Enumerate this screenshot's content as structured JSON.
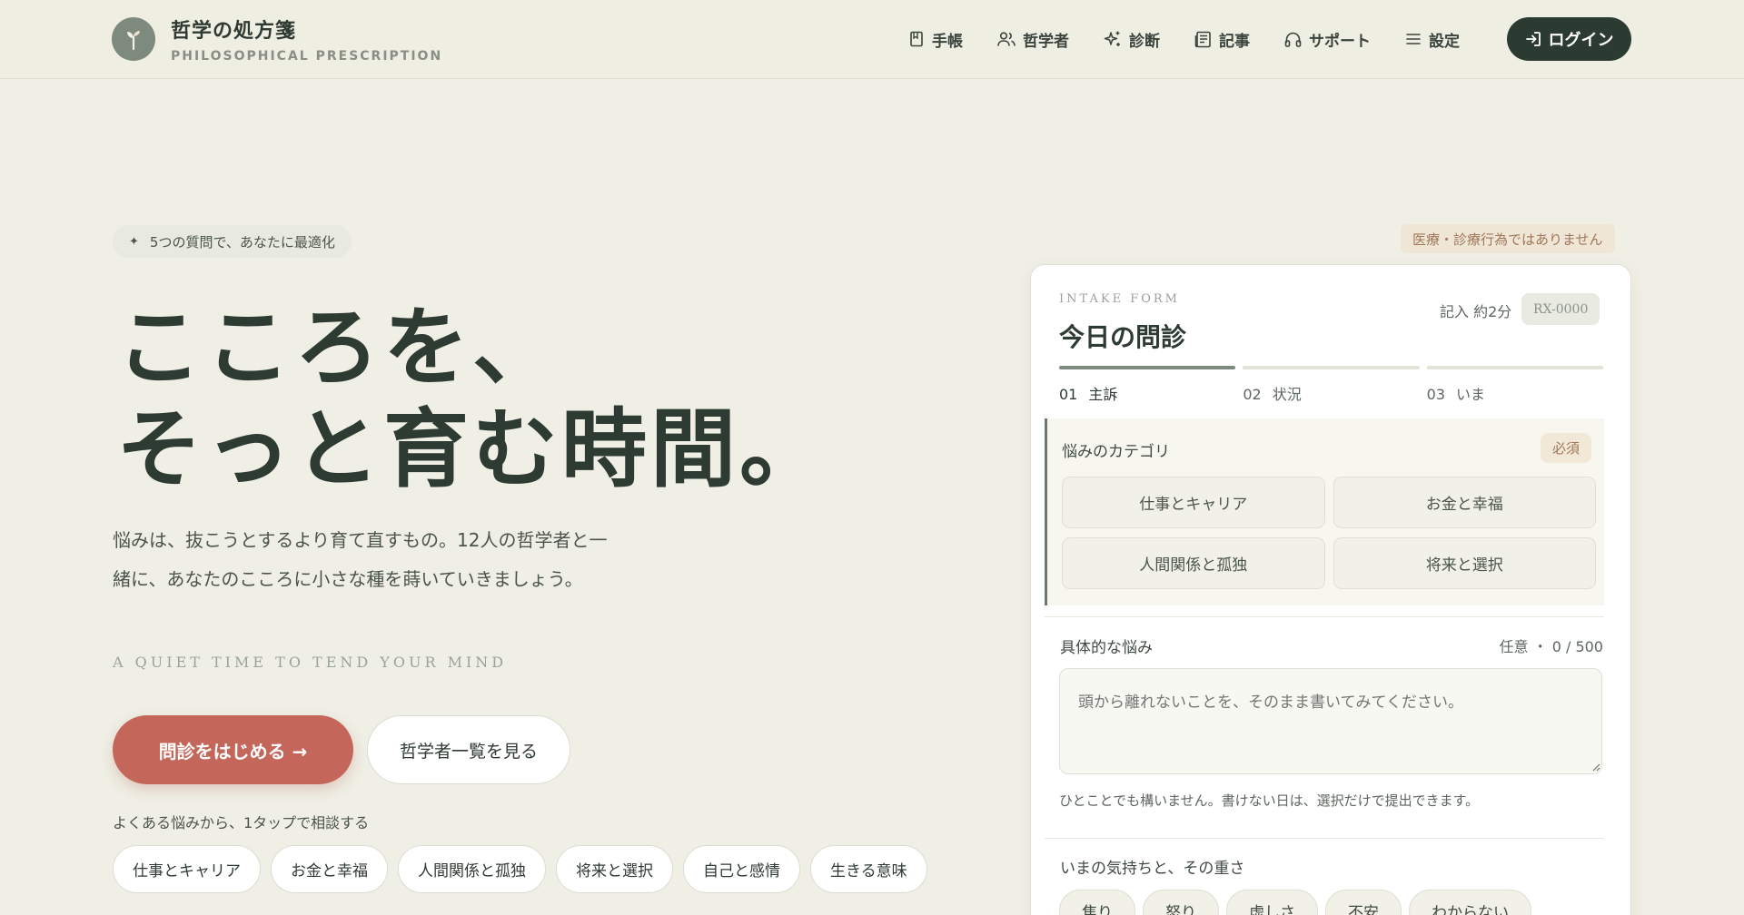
{
  "header": {
    "title": "哲学の処方箋",
    "subtitle": "PHILOSOPHICAL PRESCRIPTION",
    "nav": [
      {
        "label": "手帳",
        "icon": "notebook-icon"
      },
      {
        "label": "哲学者",
        "icon": "users-icon"
      },
      {
        "label": "診断",
        "icon": "sparkles-icon"
      },
      {
        "label": "記事",
        "icon": "newspaper-icon"
      },
      {
        "label": "サポート",
        "icon": "headphones-icon"
      },
      {
        "label": "設定",
        "icon": "menu-icon"
      }
    ],
    "login_label": "ログイン"
  },
  "hero": {
    "badge": "5つの質問で、あなたに最適化",
    "title_line1": "こころを、",
    "title_line2": "そっと育む時間。",
    "description": "悩みは、抜こうとするより育て直すもの。12人の哲学者と一緒に、あなたのこころに小さな種を蒔いていきましょう。",
    "english_tagline": "A QUIET TIME TO TEND YOUR MIND",
    "cta_primary": "問診をはじめる →",
    "cta_secondary": "哲学者一覧を見る",
    "quick_label": "よくある悩みから、1タップで相談する",
    "quick_chips": [
      "仕事とキャリア",
      "お金と幸福",
      "人間関係と孤独",
      "将来と選択",
      "自己と感情",
      "生きる意味"
    ]
  },
  "form": {
    "disclaimer": "医療・診療行為ではありません",
    "intake_label": "INTAKE FORM",
    "title": "今日の問診",
    "time_estimate": "記入 約2分",
    "rx_code": "RX-0000",
    "steps": [
      {
        "num": "01",
        "label": "主訴"
      },
      {
        "num": "02",
        "label": "状況"
      },
      {
        "num": "03",
        "label": "いま"
      }
    ],
    "category_title": "悩みのカテゴリ",
    "required_label": "必須",
    "categories": [
      "仕事とキャリア",
      "お金と幸福",
      "人間関係と孤独",
      "将来と選択"
    ],
    "detail_title": "具体的な悩み",
    "detail_count": "任意 ・ 0 / 500",
    "detail_placeholder": "頭から離れないことを、そのまま書いてみてください。",
    "helper": "ひとことでも構いません。書けない日は、選択だけで提出できます。",
    "mood_title": "いまの気持ちと、その重さ",
    "moods": [
      "焦り",
      "怒り",
      "虚しさ",
      "不安",
      "わからない"
    ]
  }
}
